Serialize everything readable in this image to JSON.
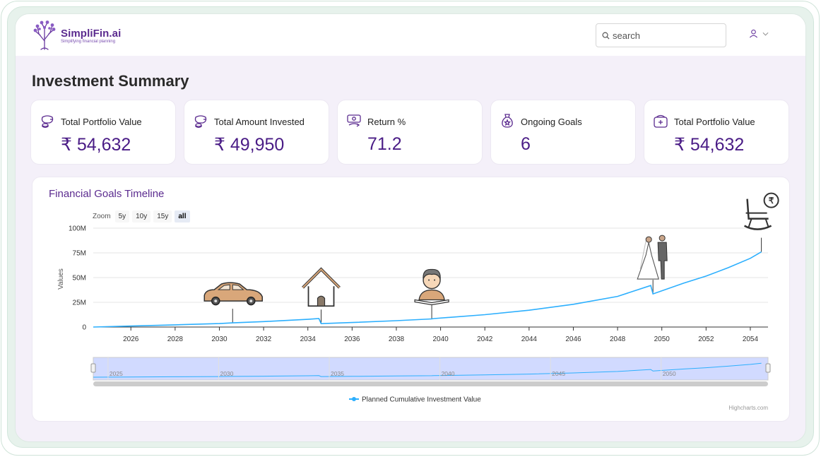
{
  "brand": {
    "name": "SimpliFin.ai",
    "tagline": "Simplifying financial planning"
  },
  "search": {
    "placeholder": "search",
    "value": ""
  },
  "page": {
    "title": "Investment Summary"
  },
  "cards": [
    {
      "label": "Total Portfolio Value",
      "value": "₹ 54,632",
      "icon": "money-bag-icon"
    },
    {
      "label": "Total Amount Invested",
      "value": "₹ 49,950",
      "icon": "money-bag-icon"
    },
    {
      "label": "Return %",
      "value": "71.2",
      "icon": "return-icon"
    },
    {
      "label": "Ongoing Goals",
      "value": "6",
      "icon": "goals-icon"
    },
    {
      "label": "Total Portfolio Value",
      "value": "₹ 54,632",
      "icon": "wallet-icon"
    }
  ],
  "chart": {
    "title": "Financial Goals Timeline",
    "zoom_label": "Zoom",
    "zoom_options": [
      "5y",
      "10y",
      "15y",
      "all"
    ],
    "zoom_selected": "all",
    "credits": "Highcharts.com"
  },
  "chart_data": {
    "type": "line",
    "title": "Financial Goals Timeline",
    "ylabel": "Values",
    "xlabel": "",
    "xlim": [
      2024.3,
      2054.8
    ],
    "ylim": [
      0,
      100
    ],
    "y_ticks": [
      "0",
      "25M",
      "50M",
      "75M",
      "100M"
    ],
    "y_tick_values": [
      0,
      25,
      50,
      75,
      100
    ],
    "x_ticks": [
      "2026",
      "2028",
      "2030",
      "2032",
      "2034",
      "2036",
      "2038",
      "2040",
      "2042",
      "2044",
      "2046",
      "2048",
      "2050",
      "2052",
      "2054"
    ],
    "navigator_ticks": [
      "2025",
      "2030",
      "2035",
      "2040",
      "2045",
      "2050"
    ],
    "legend": "bottom-center",
    "grid": true,
    "series": [
      {
        "name": "Planned Cumulative Investment Value",
        "color": "#2caffe",
        "points": [
          [
            2024.3,
            0
          ],
          [
            2026,
            1.0
          ],
          [
            2028,
            2.2
          ],
          [
            2030,
            3.5
          ],
          [
            2030.6,
            4.2
          ],
          [
            2032,
            5.5
          ],
          [
            2034,
            7.8
          ],
          [
            2034.5,
            8.6
          ],
          [
            2034.6,
            3.4
          ],
          [
            2036,
            4.6
          ],
          [
            2038,
            6.4
          ],
          [
            2039.6,
            8.2
          ],
          [
            2039.7,
            8.6
          ],
          [
            2042,
            12.5
          ],
          [
            2044,
            17.0
          ],
          [
            2046,
            23.0
          ],
          [
            2048,
            31.0
          ],
          [
            2049.5,
            42.0
          ],
          [
            2049.6,
            33.5
          ],
          [
            2051,
            44.5
          ],
          [
            2052,
            51.5
          ],
          [
            2053,
            60.0
          ],
          [
            2054,
            69.5
          ],
          [
            2054.5,
            76.0
          ]
        ]
      }
    ],
    "goal_markers": [
      {
        "year": 2030.6,
        "icon": "car-icon"
      },
      {
        "year": 2034.6,
        "icon": "house-icon"
      },
      {
        "year": 2039.6,
        "icon": "education-icon"
      },
      {
        "year": 2049.6,
        "icon": "wedding-icon"
      },
      {
        "year": 2054.5,
        "icon": "retirement-icon"
      }
    ]
  }
}
